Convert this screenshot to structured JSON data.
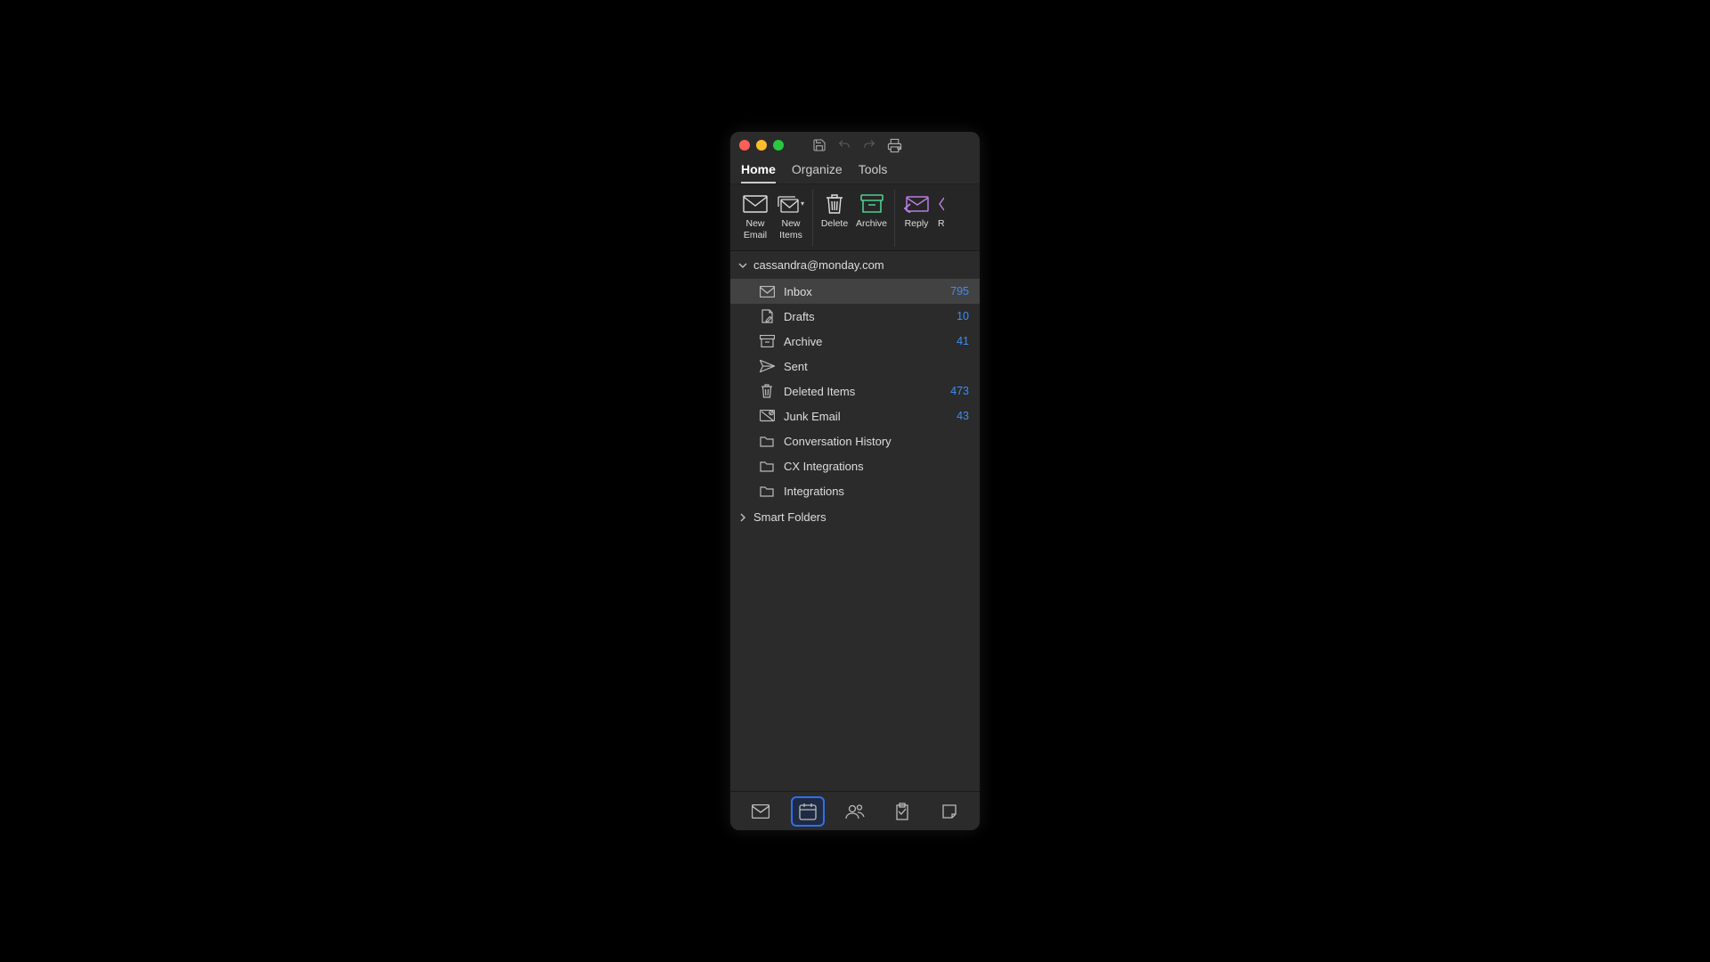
{
  "tabs": [
    "Home",
    "Organize",
    "Tools"
  ],
  "activeTab": 0,
  "ribbon": {
    "newEmail": "New\nEmail",
    "newItems": "New\nItems",
    "delete": "Delete",
    "archive": "Archive",
    "reply": "Reply",
    "replyAll": "R"
  },
  "account": {
    "email": "cassandra@monday.com",
    "folders": [
      {
        "name": "Inbox",
        "count": "795",
        "icon": "inbox",
        "selected": true
      },
      {
        "name": "Drafts",
        "count": "10",
        "icon": "drafts"
      },
      {
        "name": "Archive",
        "count": "41",
        "icon": "archive"
      },
      {
        "name": "Sent",
        "count": "",
        "icon": "sent"
      },
      {
        "name": "Deleted Items",
        "count": "473",
        "icon": "trash"
      },
      {
        "name": "Junk Email",
        "count": "43",
        "icon": "junk"
      },
      {
        "name": "Conversation History",
        "count": "",
        "icon": "folder"
      },
      {
        "name": "CX Integrations",
        "count": "",
        "icon": "folder"
      },
      {
        "name": "Integrations",
        "count": "",
        "icon": "folder"
      }
    ]
  },
  "smartFolders": "Smart Folders",
  "nav": [
    "mail",
    "calendar",
    "people",
    "tasks",
    "notes"
  ]
}
